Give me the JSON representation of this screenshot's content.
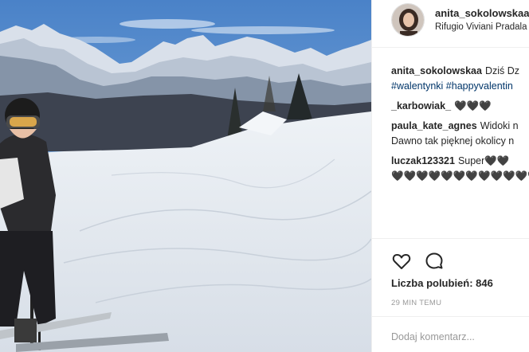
{
  "post": {
    "author": "anita_sokolowskaa",
    "location": "Rifugio Viviani Pradala",
    "caption_text": "Dziś Dz",
    "caption_tags": "#walentynki #happyvalentin",
    "photo_alt": "Skier posing on snowy slope with Dolomites mountains"
  },
  "comments": [
    {
      "user": "_karbowiak_",
      "text": "🖤🖤🖤"
    },
    {
      "user": "paula_kate_agnes",
      "text": "Widoki n",
      "text2": "Dawno tak pięknej okolicy n"
    },
    {
      "user": "luczak123321",
      "text": "Super🖤🖤",
      "text2": "🖤🖤🖤🖤🖤🖤🖤🖤🖤🖤🖤🖤"
    }
  ],
  "actions": {
    "like_icon": "heart-outline-icon",
    "comment_icon": "speech-bubble-icon",
    "likes_label": "Liczba polubień: 846",
    "time": "29 MIN TEMU",
    "add_comment_placeholder": "Dodaj komentarz..."
  }
}
